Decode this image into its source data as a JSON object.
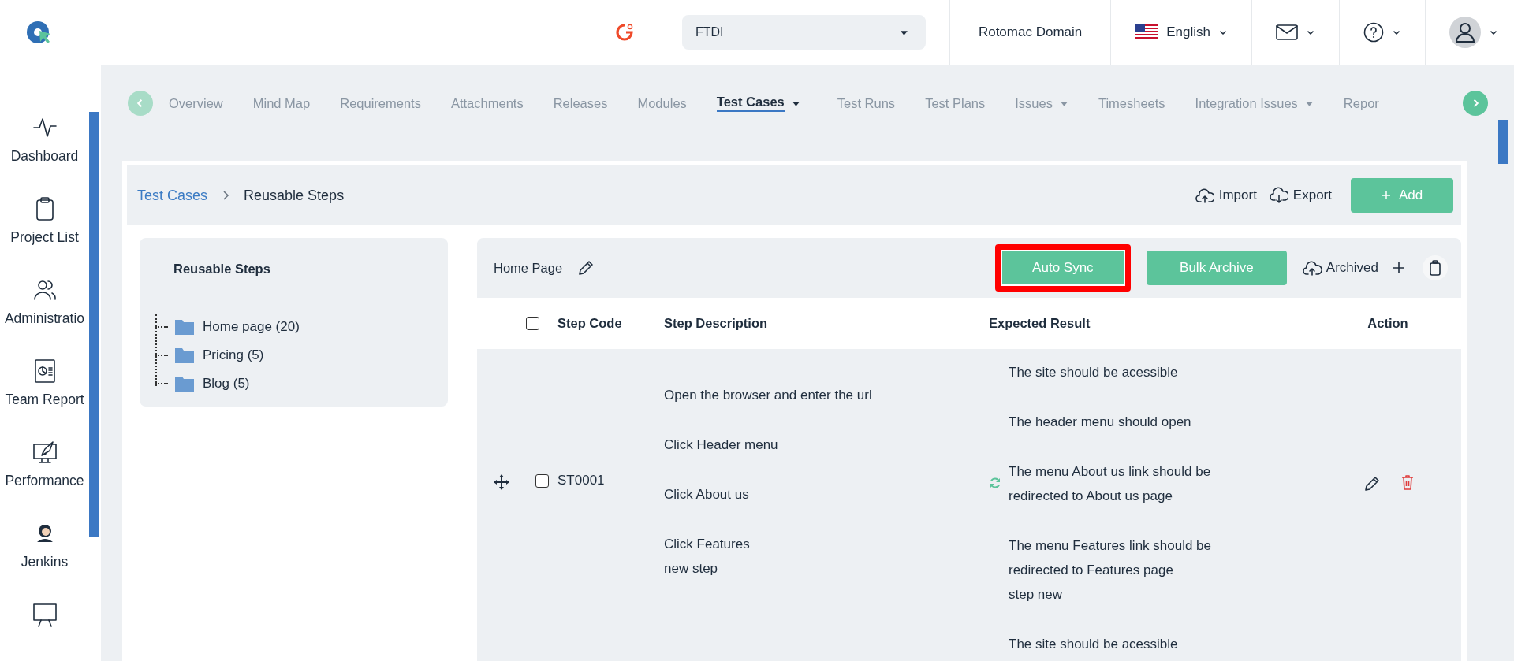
{
  "header": {
    "project_select": {
      "value": "FTDI"
    },
    "domain": "Rotomac Domain",
    "language": "English"
  },
  "sidebar": {
    "items": [
      {
        "kind": "pulse",
        "label": "Dashboard"
      },
      {
        "kind": "clipboard",
        "label": "Project List"
      },
      {
        "kind": "users",
        "label": "Administratio"
      },
      {
        "kind": "report",
        "label": "Team Report"
      },
      {
        "kind": "rocket",
        "label": "Performance"
      },
      {
        "kind": "butler",
        "label": "Jenkins"
      },
      {
        "kind": "board"
      }
    ]
  },
  "tabs": [
    {
      "label": "Overview",
      "selected": false,
      "dropdown": false
    },
    {
      "label": "Mind Map",
      "selected": false,
      "dropdown": false
    },
    {
      "label": "Requirements",
      "selected": false,
      "dropdown": false
    },
    {
      "label": "Attachments",
      "selected": false,
      "dropdown": false
    },
    {
      "label": "Releases",
      "selected": false,
      "dropdown": false
    },
    {
      "label": "Modules",
      "selected": false,
      "dropdown": false
    },
    {
      "label": "Test Cases",
      "selected": true,
      "dropdown": true
    },
    {
      "label": "Test Runs",
      "selected": false,
      "dropdown": false
    },
    {
      "label": "Test Plans",
      "selected": false,
      "dropdown": false
    },
    {
      "label": "Issues",
      "selected": false,
      "dropdown": true
    },
    {
      "label": "Timesheets",
      "selected": false,
      "dropdown": false
    },
    {
      "label": "Integration Issues",
      "selected": false,
      "dropdown": true
    },
    {
      "label": "Repor",
      "selected": false,
      "dropdown": false
    }
  ],
  "breadcrumb": [
    "Test Cases",
    "Reusable Steps"
  ],
  "toolbar": {
    "import": "Import",
    "export": "Export",
    "add": "Add"
  },
  "tree": {
    "title": "Reusable Steps",
    "items": [
      {
        "label": "Home page (20)"
      },
      {
        "label": "Pricing (5)"
      },
      {
        "label": "Blog (5)"
      }
    ]
  },
  "steps": {
    "title": "Home Page",
    "buttons": [
      {
        "label": "Auto Sync",
        "highlighted": true
      },
      {
        "label": "Bulk Archive",
        "highlighted": false
      }
    ],
    "archived": "Archived",
    "columns": [
      "Step Code",
      "Step Description",
      "Expected Result",
      "Action"
    ],
    "all_checked": false,
    "rows": [
      {
        "checked": false,
        "code": "ST0001",
        "description": [
          [
            "Open the browser and enter the url"
          ],
          [
            "Click Header menu"
          ],
          [
            "Click About us"
          ],
          [
            "Click Features",
            "new step"
          ]
        ],
        "expected": [
          [
            "The site should be acessible"
          ],
          [
            "The header menu should open"
          ],
          [
            "The menu About us link should be",
            "redirected to About us page"
          ],
          [
            "The menu Features link should be",
            "redirected to Features page",
            "step new"
          ],
          [
            "The site should be acessible"
          ]
        ]
      }
    ]
  }
}
